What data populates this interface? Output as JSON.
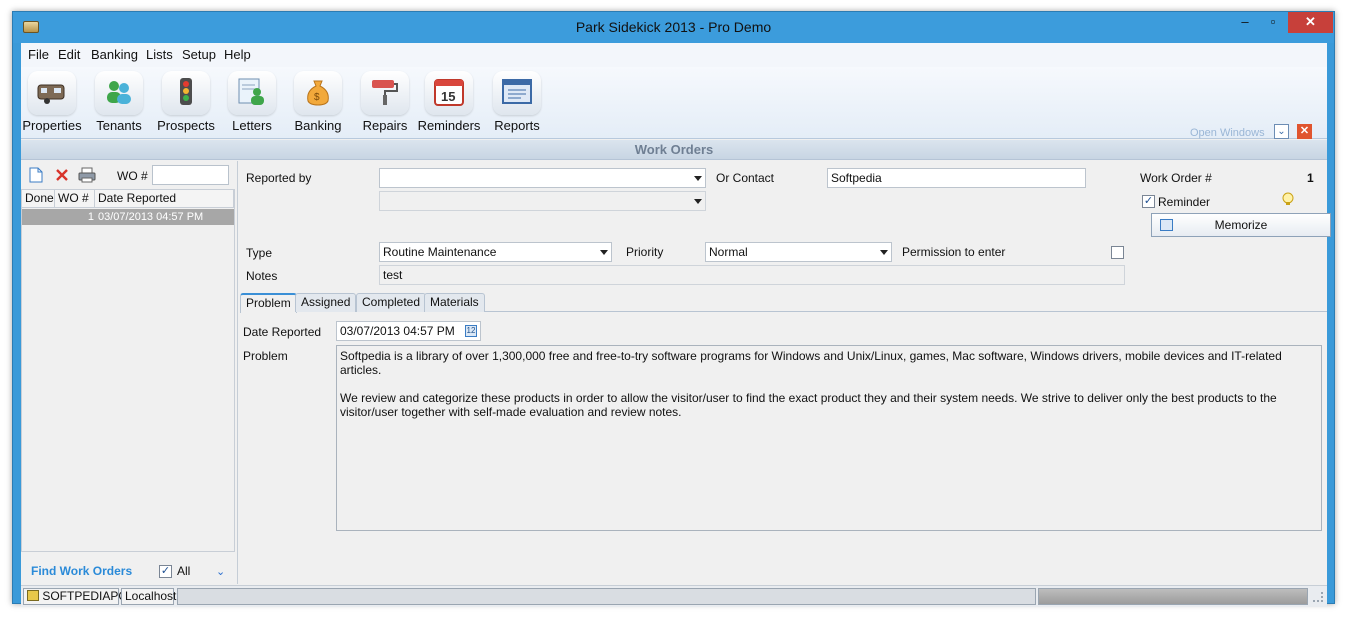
{
  "window": {
    "title": "Park Sidekick 2013 - Pro Demo",
    "min": "–",
    "max": "▫",
    "close": "✕"
  },
  "menu": [
    "File",
    "Edit",
    "Banking",
    "Lists",
    "Setup",
    "Help"
  ],
  "ribbon": {
    "buttons": [
      {
        "label": "Properties",
        "icon": "trailer-icon"
      },
      {
        "label": "Tenants",
        "icon": "people-icon"
      },
      {
        "label": "Prospects",
        "icon": "traffic-light-icon"
      },
      {
        "label": "Letters",
        "icon": "letter-person-icon"
      },
      {
        "label": "Banking",
        "icon": "money-bag-icon"
      },
      {
        "label": "Repairs",
        "icon": "paint-roller-icon"
      },
      {
        "label": "Reminders",
        "icon": "calendar-icon"
      },
      {
        "label": "Reports",
        "icon": "report-icon"
      }
    ],
    "calendar_day": "15",
    "open_windows": "Open Windows"
  },
  "section_title": "Work Orders",
  "left": {
    "wo_label": "WO #",
    "columns": [
      "Done",
      "WO #",
      "Date Reported"
    ],
    "rows": [
      {
        "done": "",
        "wo": "1",
        "date": "03/07/2013 04:57 PM"
      }
    ],
    "find_label": "Find Work Orders",
    "all_label": "All",
    "all_checked": "✓"
  },
  "form": {
    "reported_by_label": "Reported by",
    "reported_by_value": "",
    "or_contact_label": "Or Contact",
    "or_contact_value": "Softpedia",
    "work_order_label": "Work Order #",
    "work_order_value": "1",
    "reminder_label": "Reminder",
    "reminder_checked": "✓",
    "memorize_label": "Memorize",
    "type_label": "Type",
    "type_value": "Routine Maintenance",
    "priority_label": "Priority",
    "priority_value": "Normal",
    "permission_label": "Permission to enter",
    "notes_label": "Notes",
    "notes_value": "test"
  },
  "tabs": [
    "Problem",
    "Assigned",
    "Completed",
    "Materials"
  ],
  "problem": {
    "date_label": "Date Reported",
    "date_value": "03/07/2013 04:57 PM",
    "problem_label": "Problem",
    "text_p1": "Softpedia is a library of over 1,300,000 free and free-to-try software programs for Windows and Unix/Linux, games, Mac software, Windows drivers, mobile devices and IT-related articles.",
    "text_p2": "We review and categorize these products in order to allow the visitor/user to find the exact product they and their system needs. We strive to deliver only the best products to the visitor/user together with self-made evaluation and review notes."
  },
  "status": {
    "computer": "SOFTPEDIAPC",
    "server": "Localhost"
  }
}
